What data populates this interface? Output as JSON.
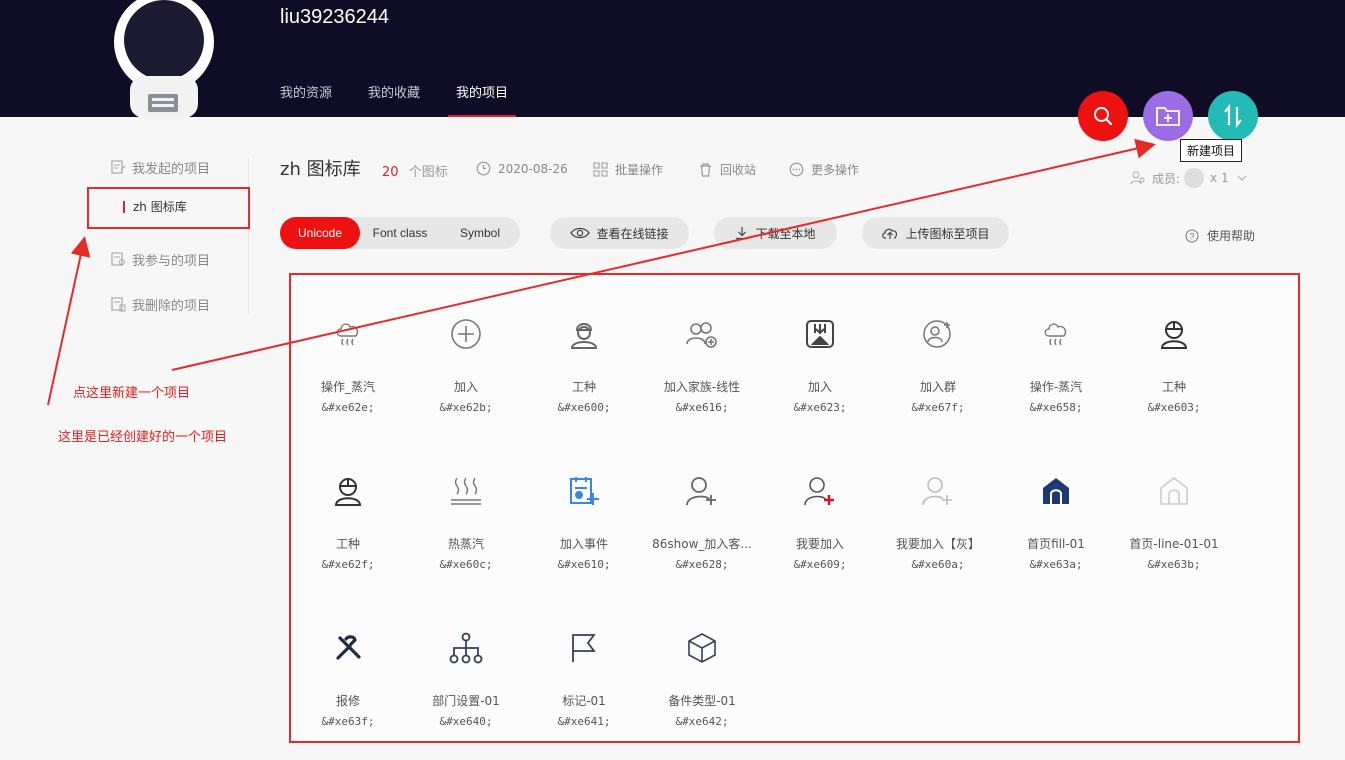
{
  "header": {
    "username": "liu39236244",
    "nav": [
      {
        "label": "我的资源"
      },
      {
        "label": "我的收藏"
      },
      {
        "label": "我的项目",
        "active": true
      }
    ],
    "new_project_tooltip": "新建项目"
  },
  "sidebar": {
    "items": [
      {
        "label": "我发起的项目"
      },
      {
        "label": "我参与的项目"
      },
      {
        "label": "我删除的项目"
      }
    ],
    "sub_item": "zh 图标库"
  },
  "project": {
    "title": "zh 图标库",
    "count": "20",
    "count_unit": "个图标",
    "date": "2020-08-26",
    "batch": "批量操作",
    "recycle": "回收站",
    "more": "更多操作",
    "members_label": "成员:",
    "members_count": "x 1"
  },
  "toolbar": {
    "tabs": [
      "Unicode",
      "Font class",
      "Symbol"
    ],
    "active_tab": "Unicode",
    "view_link": "查看在线链接",
    "download": "下载至本地",
    "upload": "上传图标至项目",
    "help": "使用帮助"
  },
  "icons": [
    {
      "name": "操作_蒸汽",
      "code": "&#xe62e;",
      "icon": "cloud-steam-icon"
    },
    {
      "name": "加入",
      "code": "&#xe62b;",
      "icon": "plus-circle-icon"
    },
    {
      "name": "工种",
      "code": "&#xe600;",
      "icon": "worker-icon"
    },
    {
      "name": "加入家族-线性",
      "code": "&#xe616;",
      "icon": "add-family-icon"
    },
    {
      "name": "加入",
      "code": "&#xe623;",
      "icon": "join-box-icon"
    },
    {
      "name": "加入群",
      "code": "&#xe67f;",
      "icon": "join-group-icon"
    },
    {
      "name": "操作-蒸汽",
      "code": "&#xe658;",
      "icon": "cloud-steam-icon"
    },
    {
      "name": "工种",
      "code": "&#xe603;",
      "icon": "worker-helmet-icon"
    },
    {
      "name": "工种",
      "code": "&#xe62f;",
      "icon": "worker-helmet-icon"
    },
    {
      "name": "热蒸汽",
      "code": "&#xe60c;",
      "icon": "hot-steam-icon"
    },
    {
      "name": "加入事件",
      "code": "&#xe610;",
      "icon": "add-event-icon"
    },
    {
      "name": "86show_加入客...",
      "code": "&#xe628;",
      "icon": "add-user-icon"
    },
    {
      "name": "我要加入",
      "code": "&#xe609;",
      "icon": "add-user-red-icon"
    },
    {
      "name": "我要加入【灰】",
      "code": "&#xe60a;",
      "icon": "add-user-gray-icon"
    },
    {
      "name": "首页fill-01",
      "code": "&#xe63a;",
      "icon": "home-fill-icon"
    },
    {
      "name": "首页-line-01-01",
      "code": "&#xe63b;",
      "icon": "home-line-icon"
    },
    {
      "name": "报修",
      "code": "&#xe63f;",
      "icon": "repair-tools-icon"
    },
    {
      "name": "部门设置-01",
      "code": "&#xe640;",
      "icon": "org-tree-icon"
    },
    {
      "name": "标记-01",
      "code": "&#xe641;",
      "icon": "flag-icon"
    },
    {
      "name": "备件类型-01",
      "code": "&#xe642;",
      "icon": "cube-icon"
    }
  ],
  "annotations": {
    "new_project_hint": "点这里新建一个项目",
    "existing_project_hint": "这里是已经创建好的一个项目"
  },
  "colors": {
    "header_bg": "#0f0d26",
    "accent_red": "#ee1111",
    "new_btn_purple": "#9b6ce6",
    "sort_btn_teal": "#22bbb6",
    "annotation_red": "#e52a2a"
  }
}
